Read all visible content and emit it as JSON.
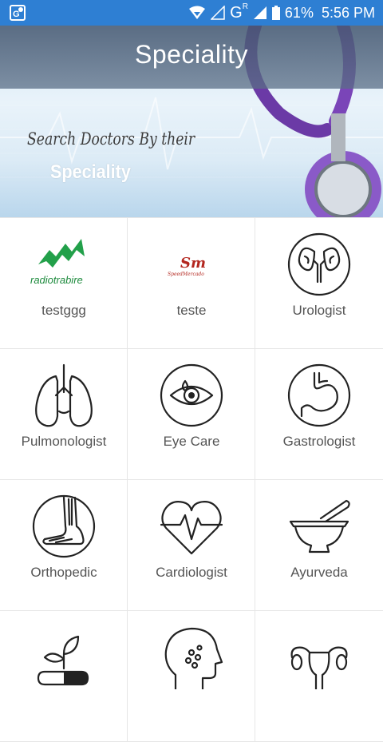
{
  "status_bar": {
    "network": "G",
    "network_sup": "R",
    "battery": "61%",
    "time": "5:56 PM",
    "bg_color": "#2e7fd3"
  },
  "header": {
    "title": "Speciality",
    "tagline_line1": "Search Doctors By their",
    "tagline_line2": "Speciality"
  },
  "specialities": [
    {
      "label": "testggg",
      "icon": "radiotrabire-logo",
      "logo_text": "radiotrabire"
    },
    {
      "label": "teste",
      "icon": "sm-logo",
      "logo_text": "Sm",
      "logo_sub": "SpeedMercado"
    },
    {
      "label": "Urologist",
      "icon": "kidneys-icon"
    },
    {
      "label": "Pulmonologist",
      "icon": "lungs-icon"
    },
    {
      "label": "Eye Care",
      "icon": "eye-icon"
    },
    {
      "label": "Gastrologist",
      "icon": "stomach-icon"
    },
    {
      "label": "Orthopedic",
      "icon": "foot-bone-icon"
    },
    {
      "label": "Cardiologist",
      "icon": "heart-pulse-icon"
    },
    {
      "label": "Ayurveda",
      "icon": "mortar-pestle-icon"
    },
    {
      "label": "",
      "icon": "herbal-capsule-icon"
    },
    {
      "label": "",
      "icon": "head-icon"
    },
    {
      "label": "",
      "icon": "uterus-icon"
    }
  ]
}
